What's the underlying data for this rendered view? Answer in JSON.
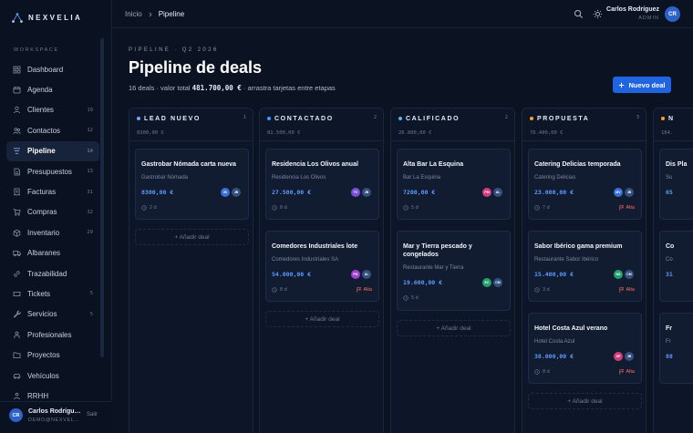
{
  "brand": {
    "name": "NEXVELIA"
  },
  "sidebar": {
    "section_label": "WORKSPACE",
    "items": [
      {
        "label": "Dashboard",
        "icon": "grid-icon"
      },
      {
        "label": "Agenda",
        "icon": "calendar-icon"
      },
      {
        "label": "Clientes",
        "icon": "user-icon",
        "count": "19"
      },
      {
        "label": "Contactos",
        "icon": "users-icon",
        "count": "12"
      },
      {
        "label": "Pipeline",
        "icon": "pipeline-icon",
        "count": "14",
        "active": true
      },
      {
        "label": "Presupuestos",
        "icon": "document-icon",
        "count": "13"
      },
      {
        "label": "Facturas",
        "icon": "invoice-icon",
        "count": "31"
      },
      {
        "label": "Compras",
        "icon": "cart-icon",
        "count": "32"
      },
      {
        "label": "Inventario",
        "icon": "box-icon",
        "count": "29"
      },
      {
        "label": "Albaranes",
        "icon": "truck-icon"
      },
      {
        "label": "Trazabilidad",
        "icon": "link-icon"
      },
      {
        "label": "Tickets",
        "icon": "ticket-icon",
        "count": "5"
      },
      {
        "label": "Servicios",
        "icon": "wrench-icon",
        "count": "5"
      },
      {
        "label": "Profesionales",
        "icon": "person-icon"
      },
      {
        "label": "Proyectos",
        "icon": "folder-icon"
      },
      {
        "label": "Vehículos",
        "icon": "car-icon"
      },
      {
        "label": "RRHH",
        "icon": "team-icon"
      }
    ],
    "footer": {
      "initials": "CR",
      "name": "Carlos Rodrígu…",
      "email": "DEMO@NEXVEL…",
      "logout_label": "Salir"
    }
  },
  "topbar": {
    "breadcrumb": [
      "Inicio",
      "Pipeline"
    ],
    "user_name": "Carlos Rodríguez",
    "user_role": "ADMIN",
    "user_initials": "CR"
  },
  "header": {
    "eyebrow": "PIPELINE · Q2 2026",
    "title": "Pipeline de deals",
    "summary_prefix": "16 deals · valor total",
    "summary_total": "481.700,00 €",
    "summary_suffix": "· arrastra tarjetas entre etapas",
    "new_deal_label": "Nuevo deal"
  },
  "add_deal_label": "+ Añadir deal",
  "columns": [
    {
      "title": "LEAD NUEVO",
      "count": "1",
      "total": "8300,00 €",
      "color": "#6fa8ff",
      "cards": [
        {
          "title": "Gastrobar Nómada carta nueva",
          "company": "Gastrobar Nómada",
          "amount": "8300,00 €",
          "days": "2 d",
          "owners": [
            [
              "IB",
              "#3b6fd9"
            ],
            [
              "JB",
              "#34507f"
            ]
          ]
        }
      ]
    },
    {
      "title": "CONTACTADO",
      "count": "2",
      "total": "81.500,00 €",
      "color": "#3d9bff",
      "cards": [
        {
          "title": "Residencia Los Olivos anual",
          "company": "Residencia Los Olivos",
          "amount": "27.500,00 €",
          "days": "8 d",
          "owners": [
            [
              "TV",
              "#7b4fd6"
            ],
            [
              "JB",
              "#34507f"
            ]
          ]
        },
        {
          "title": "Comedores Industriales lote",
          "company": "Comedores Industriales SA",
          "amount": "54.000,00 €",
          "days": "8 d",
          "priority": "Alta",
          "owners": [
            [
              "PG",
              "#a23fd1"
            ],
            [
              "AL",
              "#34507f"
            ]
          ]
        }
      ]
    },
    {
      "title": "CALIFICADO",
      "count": "2",
      "total": "26.800,00 €",
      "color": "#4db4ff",
      "cards": [
        {
          "title": "Alta Bar La Esquina",
          "company": "Bar La Esquina",
          "amount": "7200,00 €",
          "days": "5 d",
          "owners": [
            [
              "PM",
              "#d23c7a"
            ],
            [
              "AL",
              "#34507f"
            ]
          ]
        },
        {
          "title": "Mar y Tierra pescado y congelados",
          "company": "Restaurante Mar y Tierra",
          "amount": "19.600,00 €",
          "days": "5 d",
          "owners": [
            [
              "EC",
              "#22a06b"
            ],
            [
              "CM",
              "#34507f"
            ]
          ]
        }
      ]
    },
    {
      "title": "PROPUESTA",
      "count": "3",
      "total": "76.400,00 €",
      "color": "#f5a524",
      "cards": [
        {
          "title": "Catering Delicias temporada",
          "company": "Catering Delicias",
          "amount": "23.000,00 €",
          "days": "7 d",
          "priority": "Alta",
          "owners": [
            [
              "MV",
              "#3b6fd9"
            ],
            [
              "JB",
              "#34507f"
            ]
          ]
        },
        {
          "title": "Sabor Ibérico gama premium",
          "company": "Restaurante Sabor Ibérico",
          "amount": "15.400,00 €",
          "days": "3 d",
          "priority": "Alta",
          "owners": [
            [
              "NS",
              "#22a06b"
            ],
            [
              "CM",
              "#34507f"
            ]
          ]
        },
        {
          "title": "Hotel Costa Azul verano",
          "company": "Hotel Costa Azul",
          "amount": "38.000,00 €",
          "days": "8 d",
          "priority": "Alta",
          "owners": [
            [
              "SP",
              "#d23c7a"
            ],
            [
              "JB",
              "#34507f"
            ]
          ]
        }
      ]
    },
    {
      "title": "N",
      "count": "",
      "total": "184.",
      "color": "#f5a524",
      "cards": [
        {
          "title": "Dis Pla",
          "company": "Su",
          "amount": "65",
          "days": ""
        },
        {
          "title": "Co",
          "company": "Co",
          "amount": "31",
          "days": ""
        },
        {
          "title": "Fr",
          "company": "Fr",
          "amount": "88",
          "days": ""
        }
      ]
    }
  ]
}
